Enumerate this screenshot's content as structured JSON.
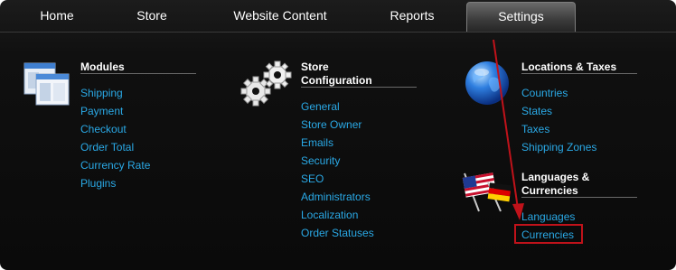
{
  "nav": {
    "home": "Home",
    "store": "Store",
    "website_content": "Website Content",
    "reports": "Reports",
    "settings": "Settings"
  },
  "modules": {
    "title": "Modules",
    "icon": "windows-icon",
    "items": [
      "Shipping",
      "Payment",
      "Checkout",
      "Order Total",
      "Currency Rate",
      "Plugins"
    ]
  },
  "store_config": {
    "title_line1": "Store",
    "title_line2": "Configuration",
    "icon": "gears-icon",
    "items": [
      "General",
      "Store Owner",
      "Emails",
      "Security",
      "SEO",
      "Administrators",
      "Localization",
      "Order Statuses"
    ]
  },
  "locations": {
    "title": "Locations & Taxes",
    "icon": "globe-icon",
    "items": [
      "Countries",
      "States",
      "Taxes",
      "Shipping Zones"
    ]
  },
  "languages": {
    "title_line1": "Languages &",
    "title_line2": "Currencies",
    "icon": "flags-icon",
    "items": [
      "Languages",
      "Currencies"
    ]
  },
  "colors": {
    "link": "#2aa9e6",
    "annotation": "#c0121a"
  }
}
